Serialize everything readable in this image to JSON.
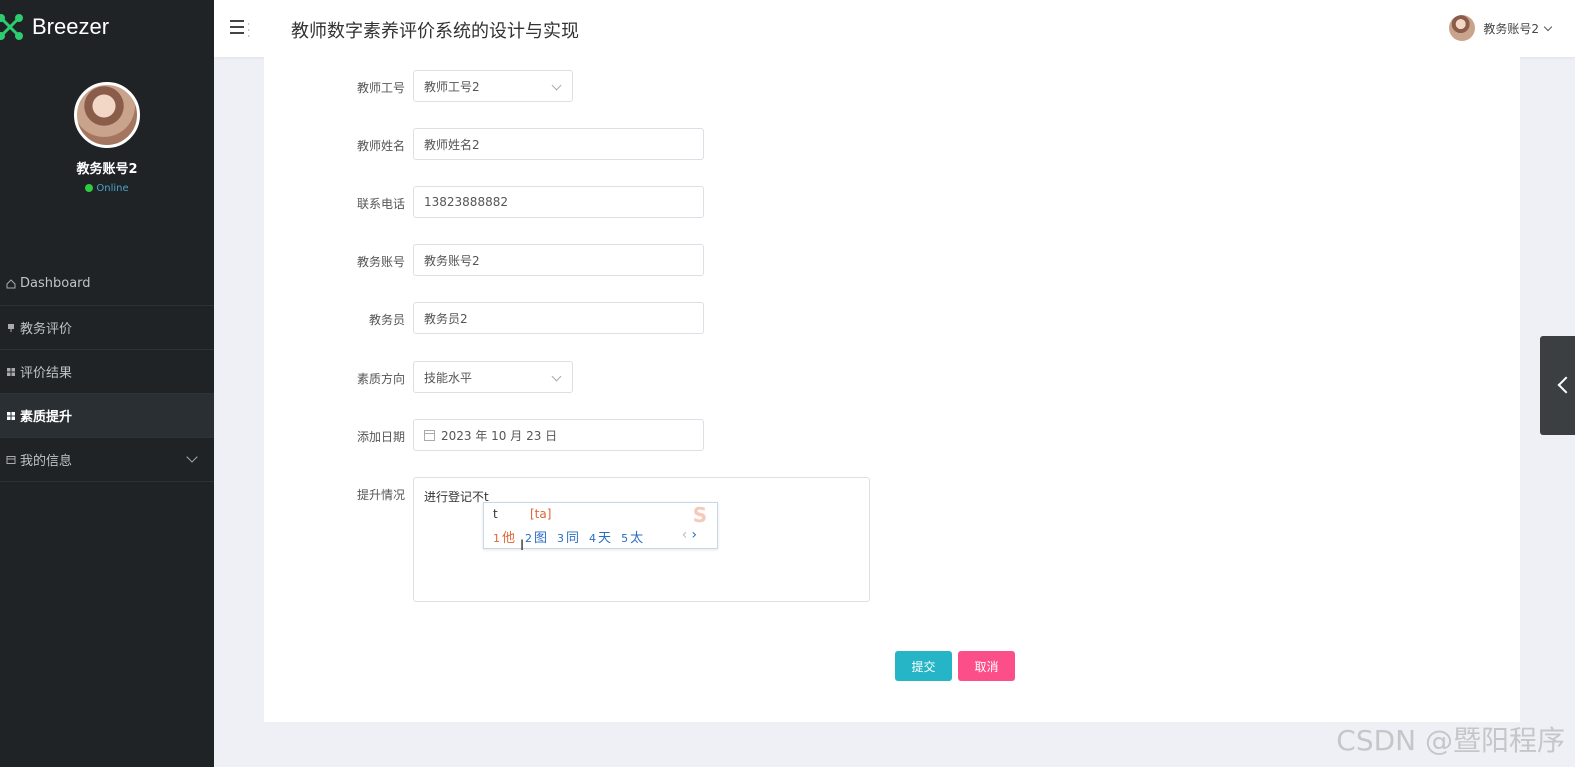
{
  "brand": {
    "name": "Breezer",
    "accent": "#25b5c6"
  },
  "sidebar": {
    "profile": {
      "name": "教务账号2",
      "status": "Online"
    },
    "items": [
      {
        "label": "Dashboard",
        "icon": "home-icon",
        "active": false
      },
      {
        "label": "教务评价",
        "icon": "pin-icon",
        "active": false
      },
      {
        "label": "评价结果",
        "icon": "grid-icon",
        "active": false
      },
      {
        "label": "素质提升",
        "icon": "grid-icon",
        "active": true
      },
      {
        "label": "我的信息",
        "icon": "card-icon",
        "active": false,
        "expandable": true
      }
    ]
  },
  "header": {
    "title": "教师数字素养评价系统的设计与实现",
    "user": "教务账号2"
  },
  "form": {
    "teacher_id": {
      "label": "教师工号",
      "value": "教师工号2"
    },
    "teacher_name": {
      "label": "教师姓名",
      "value": "教师姓名2"
    },
    "phone": {
      "label": "联系电话",
      "value": "13823888882"
    },
    "academic_account": {
      "label": "教务账号",
      "value": "教务账号2"
    },
    "academic_staff": {
      "label": "教务员",
      "value": "教务员2"
    },
    "direction": {
      "label": "素质方向",
      "value": "技能水平"
    },
    "date": {
      "label": "添加日期",
      "value": "2023 年 10 月 23 日"
    },
    "improvement": {
      "label": "提升情况",
      "value": "进行登记不t"
    },
    "submit_label": "提交",
    "cancel_label": "取消"
  },
  "ime": {
    "input": "t",
    "pinyin": "[ta]",
    "candidates": [
      {
        "num": "1",
        "char": "他"
      },
      {
        "num": "2",
        "char": "图"
      },
      {
        "num": "3",
        "char": "同"
      },
      {
        "num": "4",
        "char": "天"
      },
      {
        "num": "5",
        "char": "太"
      }
    ]
  },
  "watermark": "CSDN @暨阳程序"
}
